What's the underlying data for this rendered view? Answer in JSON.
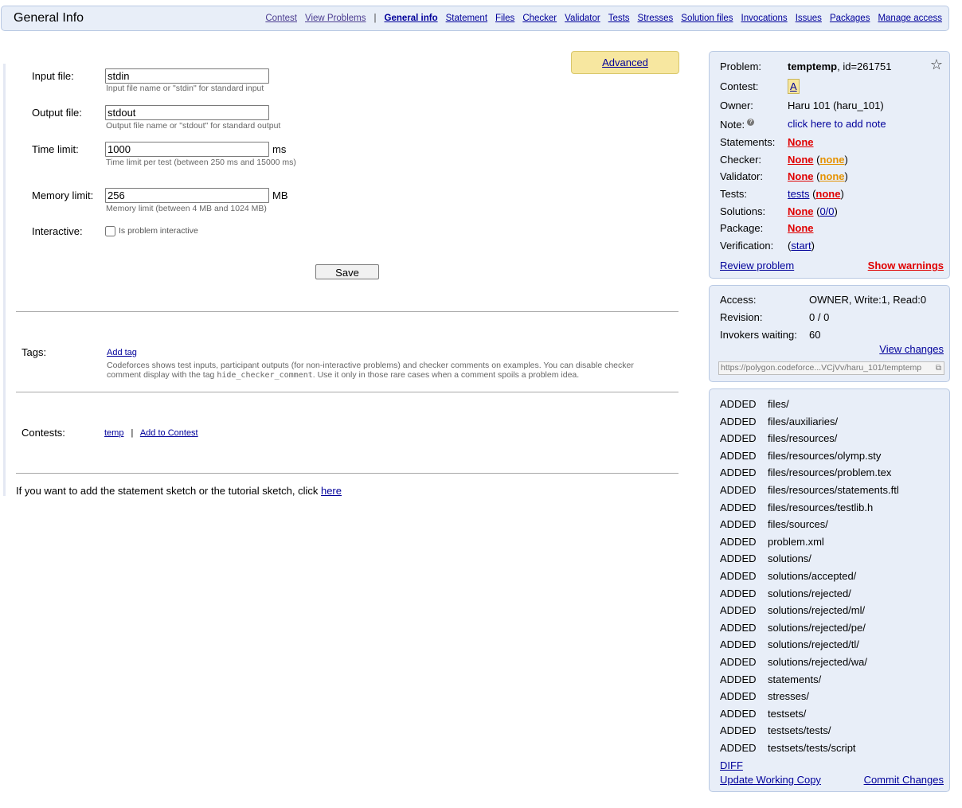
{
  "header": {
    "title": "General Info",
    "nav": [
      {
        "label": "Contest",
        "style": "gray"
      },
      {
        "label": "View Problems",
        "style": "gray"
      },
      {
        "label": "|",
        "style": "sep"
      },
      {
        "label": "General info",
        "style": "active"
      },
      {
        "label": "Statement"
      },
      {
        "label": "Files"
      },
      {
        "label": "Checker"
      },
      {
        "label": "Validator"
      },
      {
        "label": "Tests"
      },
      {
        "label": "Stresses"
      },
      {
        "label": "Solution files"
      },
      {
        "label": "Invocations"
      },
      {
        "label": "Issues"
      },
      {
        "label": "Packages"
      },
      {
        "label": "Manage access"
      }
    ]
  },
  "form": {
    "advanced_label": "Advanced",
    "input_file": {
      "label": "Input file:",
      "value": "stdin",
      "hint": "Input file name or \"stdin\" for standard input"
    },
    "output_file": {
      "label": "Output file:",
      "value": "stdout",
      "hint": "Output file name or \"stdout\" for standard output"
    },
    "time_limit": {
      "label": "Time limit:",
      "value": "1000",
      "unit": "ms",
      "hint": "Time limit per test (between 250 ms and 15000 ms)"
    },
    "memory_limit": {
      "label": "Memory limit:",
      "value": "256",
      "unit": "MB",
      "hint": "Memory limit (between 4 MB and 1024 MB)"
    },
    "interactive": {
      "label": "Interactive:",
      "checkbox_label": "Is problem interactive",
      "checked": false
    },
    "save_label": "Save"
  },
  "tags": {
    "label": "Tags:",
    "add_tag": "Add tag",
    "description_1": "Codeforces shows test inputs, participant outputs (for non-interactive problems) and checker comments on examples. You can disable checker comment display with the tag ",
    "tag_code": "hide_checker_comment",
    "description_2": ". Use it only in those rare cases when a comment spoils a problem idea."
  },
  "contests": {
    "label": "Contests:",
    "contest_link": "temp",
    "separator": "|",
    "add_link": "Add to Contest"
  },
  "sketch": {
    "text": "If you want to add the statement sketch or the tutorial sketch, click ",
    "link": "here"
  },
  "problem_panel": {
    "problem_label": "Problem:",
    "problem_name": "temptemp",
    "problem_id": ", id=261751",
    "contest_label": "Contest:",
    "contest_value": "A",
    "owner_label": "Owner:",
    "owner_value": "Haru 101 (haru_101)",
    "note_label": "Note:",
    "note_icon": "?",
    "note_value": "click here to add note",
    "statements_label": "Statements:",
    "statements_value": "None",
    "checker_label": "Checker:",
    "checker_value": "None",
    "checker_paren": "none",
    "validator_label": "Validator:",
    "validator_value": "None",
    "validator_paren": "none",
    "tests_label": "Tests:",
    "tests_value": "tests",
    "tests_paren": "none",
    "solutions_label": "Solutions:",
    "solutions_value": "None",
    "solutions_paren": "0/0",
    "package_label": "Package:",
    "package_value": "None",
    "verification_label": "Verification:",
    "verification_value": "start",
    "review_link": "Review problem",
    "warnings_link": "Show warnings"
  },
  "access_panel": {
    "access_label": "Access:",
    "access_value": "OWNER, Write:1, Read:0",
    "revision_label": "Revision:",
    "revision_value": "0 / 0",
    "invokers_label": "Invokers waiting:",
    "invokers_value": "60",
    "view_changes": "View changes",
    "url": "https://polygon.codeforce...VCjVv/haru_101/temptemp"
  },
  "changes_panel": {
    "rows": [
      {
        "action": "ADDED",
        "path": "files/"
      },
      {
        "action": "ADDED",
        "path": "files/auxiliaries/"
      },
      {
        "action": "ADDED",
        "path": "files/resources/"
      },
      {
        "action": "ADDED",
        "path": "files/resources/olymp.sty"
      },
      {
        "action": "ADDED",
        "path": "files/resources/problem.tex"
      },
      {
        "action": "ADDED",
        "path": "files/resources/statements.ftl"
      },
      {
        "action": "ADDED",
        "path": "files/resources/testlib.h"
      },
      {
        "action": "ADDED",
        "path": "files/sources/"
      },
      {
        "action": "ADDED",
        "path": "problem.xml"
      },
      {
        "action": "ADDED",
        "path": "solutions/"
      },
      {
        "action": "ADDED",
        "path": "solutions/accepted/"
      },
      {
        "action": "ADDED",
        "path": "solutions/rejected/"
      },
      {
        "action": "ADDED",
        "path": "solutions/rejected/ml/"
      },
      {
        "action": "ADDED",
        "path": "solutions/rejected/pe/"
      },
      {
        "action": "ADDED",
        "path": "solutions/rejected/tl/"
      },
      {
        "action": "ADDED",
        "path": "solutions/rejected/wa/"
      },
      {
        "action": "ADDED",
        "path": "statements/"
      },
      {
        "action": "ADDED",
        "path": "stresses/"
      },
      {
        "action": "ADDED",
        "path": "testsets/"
      },
      {
        "action": "ADDED",
        "path": "testsets/tests/"
      },
      {
        "action": "ADDED",
        "path": "testsets/tests/script"
      }
    ],
    "diff_link": "DIFF",
    "update_link": "Update Working Copy",
    "commit_link": "Commit Changes"
  }
}
